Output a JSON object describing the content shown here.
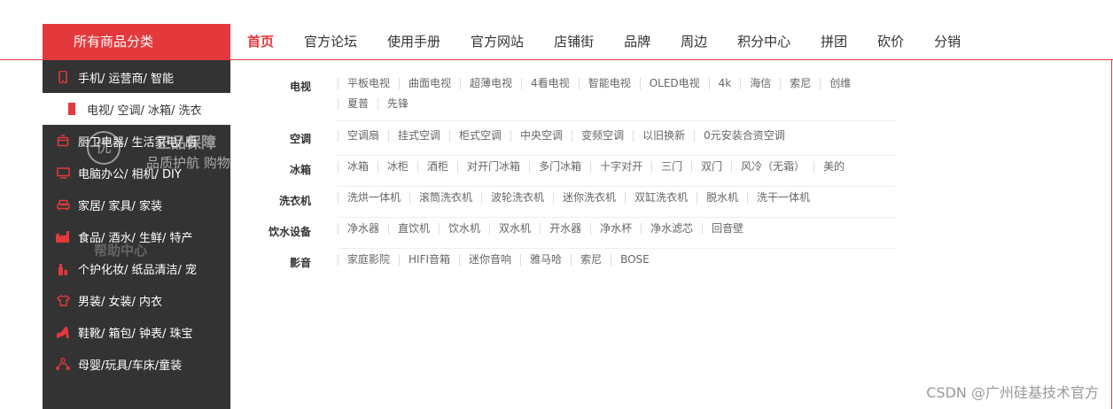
{
  "nav": {
    "category_title": "所有商品分类",
    "items": [
      "首页",
      "官方论坛",
      "使用手册",
      "官方网站",
      "店铺街",
      "品牌",
      "周边",
      "积分中心",
      "拼团",
      "砍价",
      "分销"
    ]
  },
  "sidebar": {
    "items": [
      {
        "label": "手机/ 运营商/ 智能",
        "icon": "phone-icon"
      },
      {
        "label": "电视/ 空调/ 冰箱/ 洗衣",
        "icon": "tv-icon"
      },
      {
        "label": "厨卫电器/ 生活家电/ 厨",
        "icon": "kitchen-icon"
      },
      {
        "label": "电脑办公/ 相机/ DIY",
        "icon": "computer-icon"
      },
      {
        "label": "家居/ 家具/ 家装",
        "icon": "sofa-icon"
      },
      {
        "label": "食品/ 酒水/ 生鲜/ 特产",
        "icon": "factory-icon"
      },
      {
        "label": "个护化妆/ 纸品清洁/ 宠",
        "icon": "cosmetics-icon"
      },
      {
        "label": "男装/ 女装/ 内衣",
        "icon": "shirt-icon"
      },
      {
        "label": "鞋靴/ 箱包/ 钟表/ 珠宝",
        "icon": "heel-icon"
      },
      {
        "label": "母婴/玩具/车床/童装",
        "icon": "baby-icon"
      }
    ]
  },
  "background": {
    "circle_text": "优",
    "title": "正品保障",
    "subtitle": "品质护航 购物",
    "help_title": "帮助中心"
  },
  "flyout": {
    "rows": [
      {
        "label": "电视",
        "items": [
          "平板电视",
          "曲面电视",
          "超薄电视",
          "4看电视",
          "智能电视",
          "OLED电视",
          "4k",
          "海信",
          "索尼",
          "创维",
          "夏普",
          "先锋"
        ]
      },
      {
        "label": "空调",
        "items": [
          "空调扇",
          "挂式空调",
          "柜式空调",
          "中央空调",
          "变频空调",
          "以旧换新",
          "0元安装合资空调"
        ]
      },
      {
        "label": "冰箱",
        "items": [
          "冰箱",
          "冰柜",
          "酒柜",
          "对开门冰箱",
          "多门冰箱",
          "十字对开",
          "三门",
          "双门",
          "风冷（无霜）",
          "美的"
        ]
      },
      {
        "label": "洗衣机",
        "items": [
          "洗烘一体机",
          "滚筒洗衣机",
          "波轮洗衣机",
          "迷你洗衣机",
          "双缸洗衣机",
          "脱水机",
          "洗干一体机"
        ]
      },
      {
        "label": "饮水设备",
        "items": [
          "净水器",
          "直饮机",
          "饮水机",
          "双水机",
          "开水器",
          "净水杯",
          "净水滤芯",
          "回音壁"
        ]
      },
      {
        "label": "影音",
        "items": [
          "家庭影院",
          "HIFI音箱",
          "迷你音响",
          "雅马哈",
          "索尼",
          "BOSE"
        ]
      }
    ]
  },
  "watermark": "CSDN @广州硅基技术官方",
  "colors": {
    "accent": "#e4393c",
    "sidebar_bg": "#333333"
  }
}
